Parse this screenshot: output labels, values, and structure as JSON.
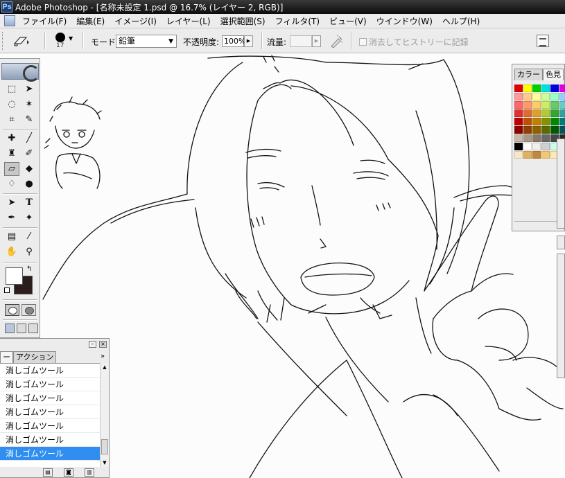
{
  "window": {
    "title": "Adobe Photoshop - [名称未設定 1.psd @ 16.7% (レイヤー 2, RGB)]"
  },
  "menu": [
    "ファイル(F)",
    "編集(E)",
    "イメージ(I)",
    "レイヤー(L)",
    "選択範囲(S)",
    "フィルタ(T)",
    "ビュー(V)",
    "ウインドウ(W)",
    "ヘルプ(H)"
  ],
  "options": {
    "brush_size": "17",
    "mode_label": "モード:",
    "mode_value": "鉛筆",
    "opacity_label": "不透明度:",
    "opacity_value": "100%",
    "flow_label": "流量:",
    "flow_value": "",
    "erase_to_history_label": "消去してヒストリーに記録"
  },
  "swatches": {
    "tabs": [
      "カラー",
      "色見"
    ],
    "colors": [
      "#e00000",
      "#ffff00",
      "#00d000",
      "#00e0e0",
      "#0000e0",
      "#e000e0",
      "#ff9a9a",
      "#ffcc88",
      "#ffff99",
      "#ccff99",
      "#99ffcc",
      "#99ccff",
      "#ff6666",
      "#ff9966",
      "#ffcc66",
      "#ccee66",
      "#66cc66",
      "#66cccc",
      "#e03030",
      "#e06a30",
      "#e0a030",
      "#b0cc30",
      "#30a830",
      "#30a0a0",
      "#c00000",
      "#c05000",
      "#c08000",
      "#889000",
      "#008800",
      "#007a7a",
      "#900000",
      "#904000",
      "#906000",
      "#606800",
      "#005a00",
      "#005555",
      "#c8b8a8",
      "#a89888",
      "#887868",
      "#686868",
      "#484848",
      "#282828",
      "#000000",
      "#ffffff",
      "#f0f0f0",
      "#d0d0d0",
      "#c8ffe8",
      "#ffd8a0",
      "#f8e8c8",
      "#e0b060",
      "#c08838",
      "#f0c878",
      "#ffe8b0",
      "#f8d898"
    ]
  },
  "history": {
    "tabs": [
      "ー",
      "アクション"
    ],
    "items": [
      "消しゴムツール",
      "消しゴムツール",
      "消しゴムツール",
      "消しゴムツール",
      "消しゴムツール",
      "消しゴムツール",
      "消しゴムツール"
    ],
    "selected_index": 6
  }
}
